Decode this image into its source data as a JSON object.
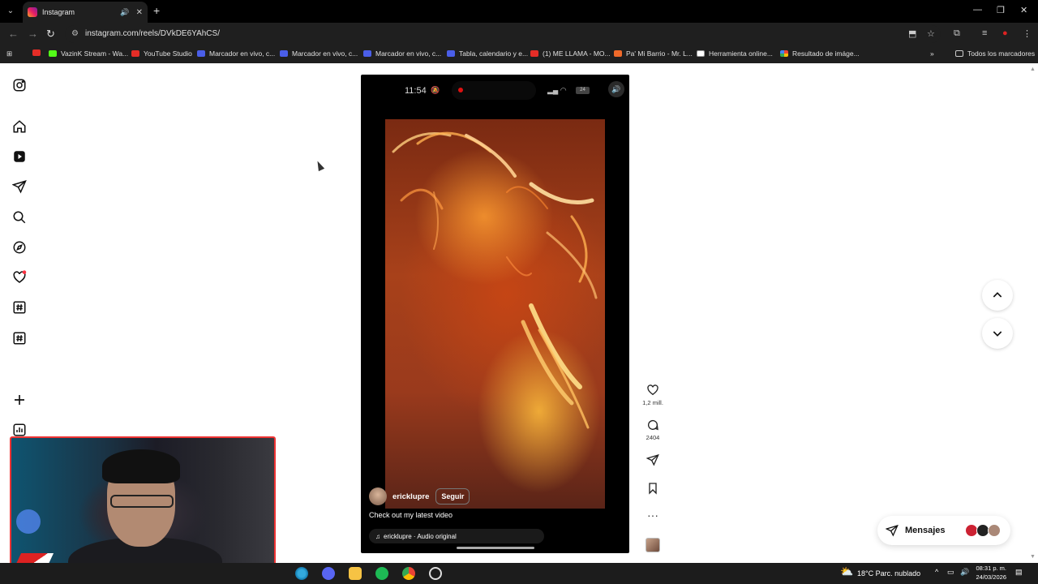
{
  "browser": {
    "tab_title": "Instagram",
    "url": "instagram.com/reels/DVkDE6YAhCS/",
    "bookmarks": [
      {
        "label": "",
        "icon": "youtube-icon"
      },
      {
        "label": "VazinK Stream - Wa...",
        "icon": "kick-icon"
      },
      {
        "label": "YouTube Studio",
        "icon": "youtube-icon"
      },
      {
        "label": "Marcador en vivo, c...",
        "icon": "sofascore-icon"
      },
      {
        "label": "Marcador en vivo, c...",
        "icon": "sofascore-icon"
      },
      {
        "label": "Marcador en vivo, c...",
        "icon": "sofascore-icon"
      },
      {
        "label": "Tabla, calendario y e...",
        "icon": "sofascore-icon"
      },
      {
        "label": "(1) ME LLAMA - MO...",
        "icon": "youtube-icon"
      },
      {
        "label": "Pa' Mi Barrio - Mr. L...",
        "icon": "pa-icon"
      },
      {
        "label": "Herramienta online...",
        "icon": "tool-icon"
      },
      {
        "label": "Resultado de imáge...",
        "icon": "google-icon"
      }
    ],
    "all_bookmarks": "Todos los marcadores"
  },
  "reel": {
    "status_time": "11:54",
    "battery": "24",
    "username": "ericklupre",
    "follow_label": "Seguir",
    "caption": "Check out my latest video",
    "audio": "ericklupre · Audio original"
  },
  "actions": {
    "likes": "1,2 mill.",
    "comments": "2404"
  },
  "messages": {
    "label": "Mensajes"
  },
  "taskbar": {
    "weather": "18°C  Parc. nublado",
    "time": "08:31 p. m.",
    "date": "24/03/2026"
  },
  "colors": {
    "accent_red": "#ff3040",
    "webcam_border": "#e33"
  }
}
